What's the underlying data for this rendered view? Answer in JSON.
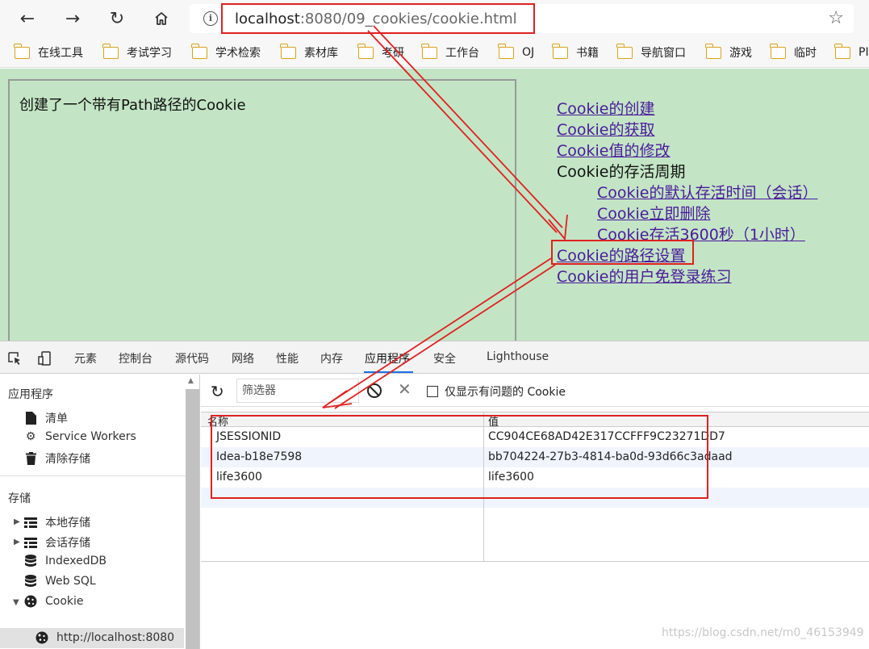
{
  "browser": {
    "url_host": "localhost",
    "url_rest": ":8080/09_cookies/cookie.html",
    "bookmarks": [
      "在线工具",
      "考试学习",
      "学术检索",
      "素材库",
      "考研",
      "工作台",
      "OJ",
      "书籍",
      "导航窗口",
      "游戏",
      "临时",
      "PI"
    ]
  },
  "page": {
    "content_text": "创建了一个带有Path路径的Cookie",
    "menu": {
      "create": "Cookie的创建",
      "get": "Cookie的获取",
      "modify": "Cookie值的修改",
      "lifecycle": "Cookie的存活周期",
      "default_life": "Cookie的默认存活时间（会话）",
      "delete_now": "Cookie立即删除",
      "life_3600": "Cookie存活3600秒（1小时）",
      "path": "Cookie的路径设置",
      "login": "Cookie的用户免登录练习"
    }
  },
  "devtools": {
    "tabs": [
      "元素",
      "控制台",
      "源代码",
      "网络",
      "性能",
      "内存",
      "应用程序",
      "安全",
      "Lighthouse"
    ],
    "active_tab": "应用程序",
    "sidebar": {
      "app_section": "应用程序",
      "manifest": "清单",
      "service_workers": "Service Workers",
      "clear_storage": "清除存储",
      "storage_section": "存储",
      "local_storage": "本地存储",
      "session_storage": "会话存储",
      "indexeddb": "IndexedDB",
      "websql": "Web SQL",
      "cookie": "Cookie",
      "cookie_origin": "http://localhost:8080"
    },
    "filter_placeholder": "筛选器",
    "only_issues_label": "仅显示有问题的 Cookie",
    "grid": {
      "col_name": "名称",
      "col_value": "值",
      "rows": [
        {
          "name": "JSESSIONID",
          "value": "CC904CE68AD42E317CCFFF9C23271DD7"
        },
        {
          "name": "Idea-b18e7598",
          "value": "bb704224-27b3-4814-ba0d-93d66c3adaad"
        },
        {
          "name": "life3600",
          "value": "life3600"
        }
      ]
    }
  },
  "watermark": "https://blog.csdn.net/m0_46153949",
  "colors": {
    "page_bg": "#c3e5c5",
    "link": "#4a1a9c",
    "highlight": "#e02020",
    "tab_underline": "#1a73e8"
  }
}
